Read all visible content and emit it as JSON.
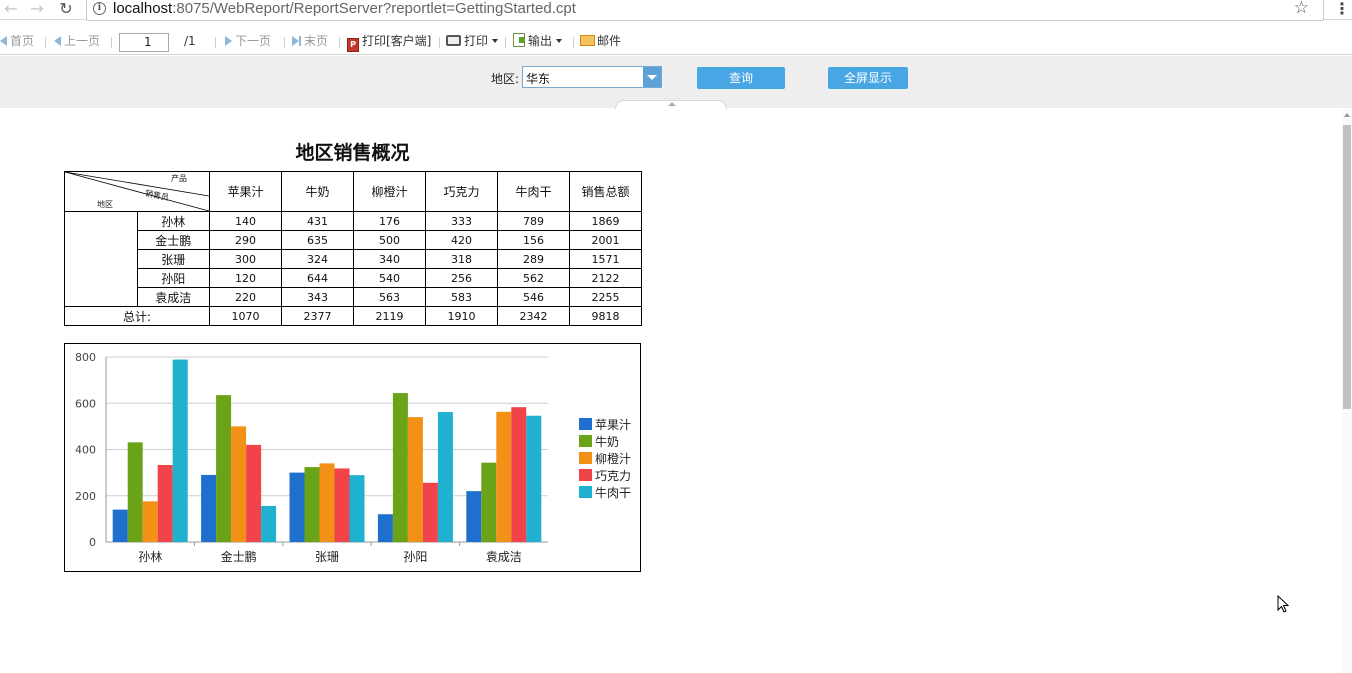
{
  "browser": {
    "url_host": "localhost",
    "url_rest": ":8075/WebReport/ReportServer?reportlet=GettingStarted.cpt"
  },
  "toolbar": {
    "first": "首页",
    "prev": "上一页",
    "page_value": "1",
    "page_total": "/1",
    "next": "下一页",
    "last": "末页",
    "print_client": "打印[客户端]",
    "print": "打印",
    "export": "输出",
    "mail": "邮件"
  },
  "params": {
    "region_label": "地区:",
    "region_value": "华东",
    "query_button": "查询",
    "fullscreen_button": "全屏显示"
  },
  "report": {
    "title": "地区销售概况",
    "corner": {
      "product": "产品",
      "salesperson": "销售员",
      "region": "地区"
    },
    "columns": [
      "苹果汁",
      "牛奶",
      "柳橙汁",
      "巧克力",
      "牛肉干",
      "销售总额"
    ],
    "rows": [
      {
        "name": "孙林",
        "values": [
          "140",
          "431",
          "176",
          "333",
          "789",
          "1869"
        ]
      },
      {
        "name": "金士鹏",
        "values": [
          "290",
          "635",
          "500",
          "420",
          "156",
          "2001"
        ]
      },
      {
        "name": "张珊",
        "values": [
          "300",
          "324",
          "340",
          "318",
          "289",
          "1571"
        ]
      },
      {
        "name": "孙阳",
        "values": [
          "120",
          "644",
          "540",
          "256",
          "562",
          "2122"
        ]
      },
      {
        "name": "袁成洁",
        "values": [
          "220",
          "343",
          "563",
          "583",
          "546",
          "2255"
        ]
      }
    ],
    "total_label": "总计:",
    "totals": [
      "1070",
      "2377",
      "2119",
      "1910",
      "2342",
      "9818"
    ]
  },
  "chart_data": {
    "type": "bar",
    "title": "",
    "xlabel": "",
    "ylabel": "",
    "categories": [
      "孙林",
      "金士鹏",
      "张珊",
      "孙阳",
      "袁成洁"
    ],
    "ylim": [
      0,
      800
    ],
    "yticks": [
      "0",
      "200",
      "400",
      "600",
      "800"
    ],
    "grid": true,
    "legend": "right",
    "series": [
      {
        "name": "苹果汁",
        "color": "#1f6fce",
        "values": [
          140,
          290,
          300,
          120,
          220
        ]
      },
      {
        "name": "牛奶",
        "color": "#6aa317",
        "values": [
          431,
          635,
          324,
          644,
          343
        ]
      },
      {
        "name": "柳橙汁",
        "color": "#f29116",
        "values": [
          176,
          500,
          340,
          540,
          563
        ]
      },
      {
        "name": "巧克力",
        "color": "#f0444a",
        "values": [
          333,
          420,
          318,
          256,
          583
        ]
      },
      {
        "name": "牛肉干",
        "color": "#1fb1cf",
        "values": [
          789,
          156,
          289,
          562,
          546
        ]
      }
    ]
  }
}
